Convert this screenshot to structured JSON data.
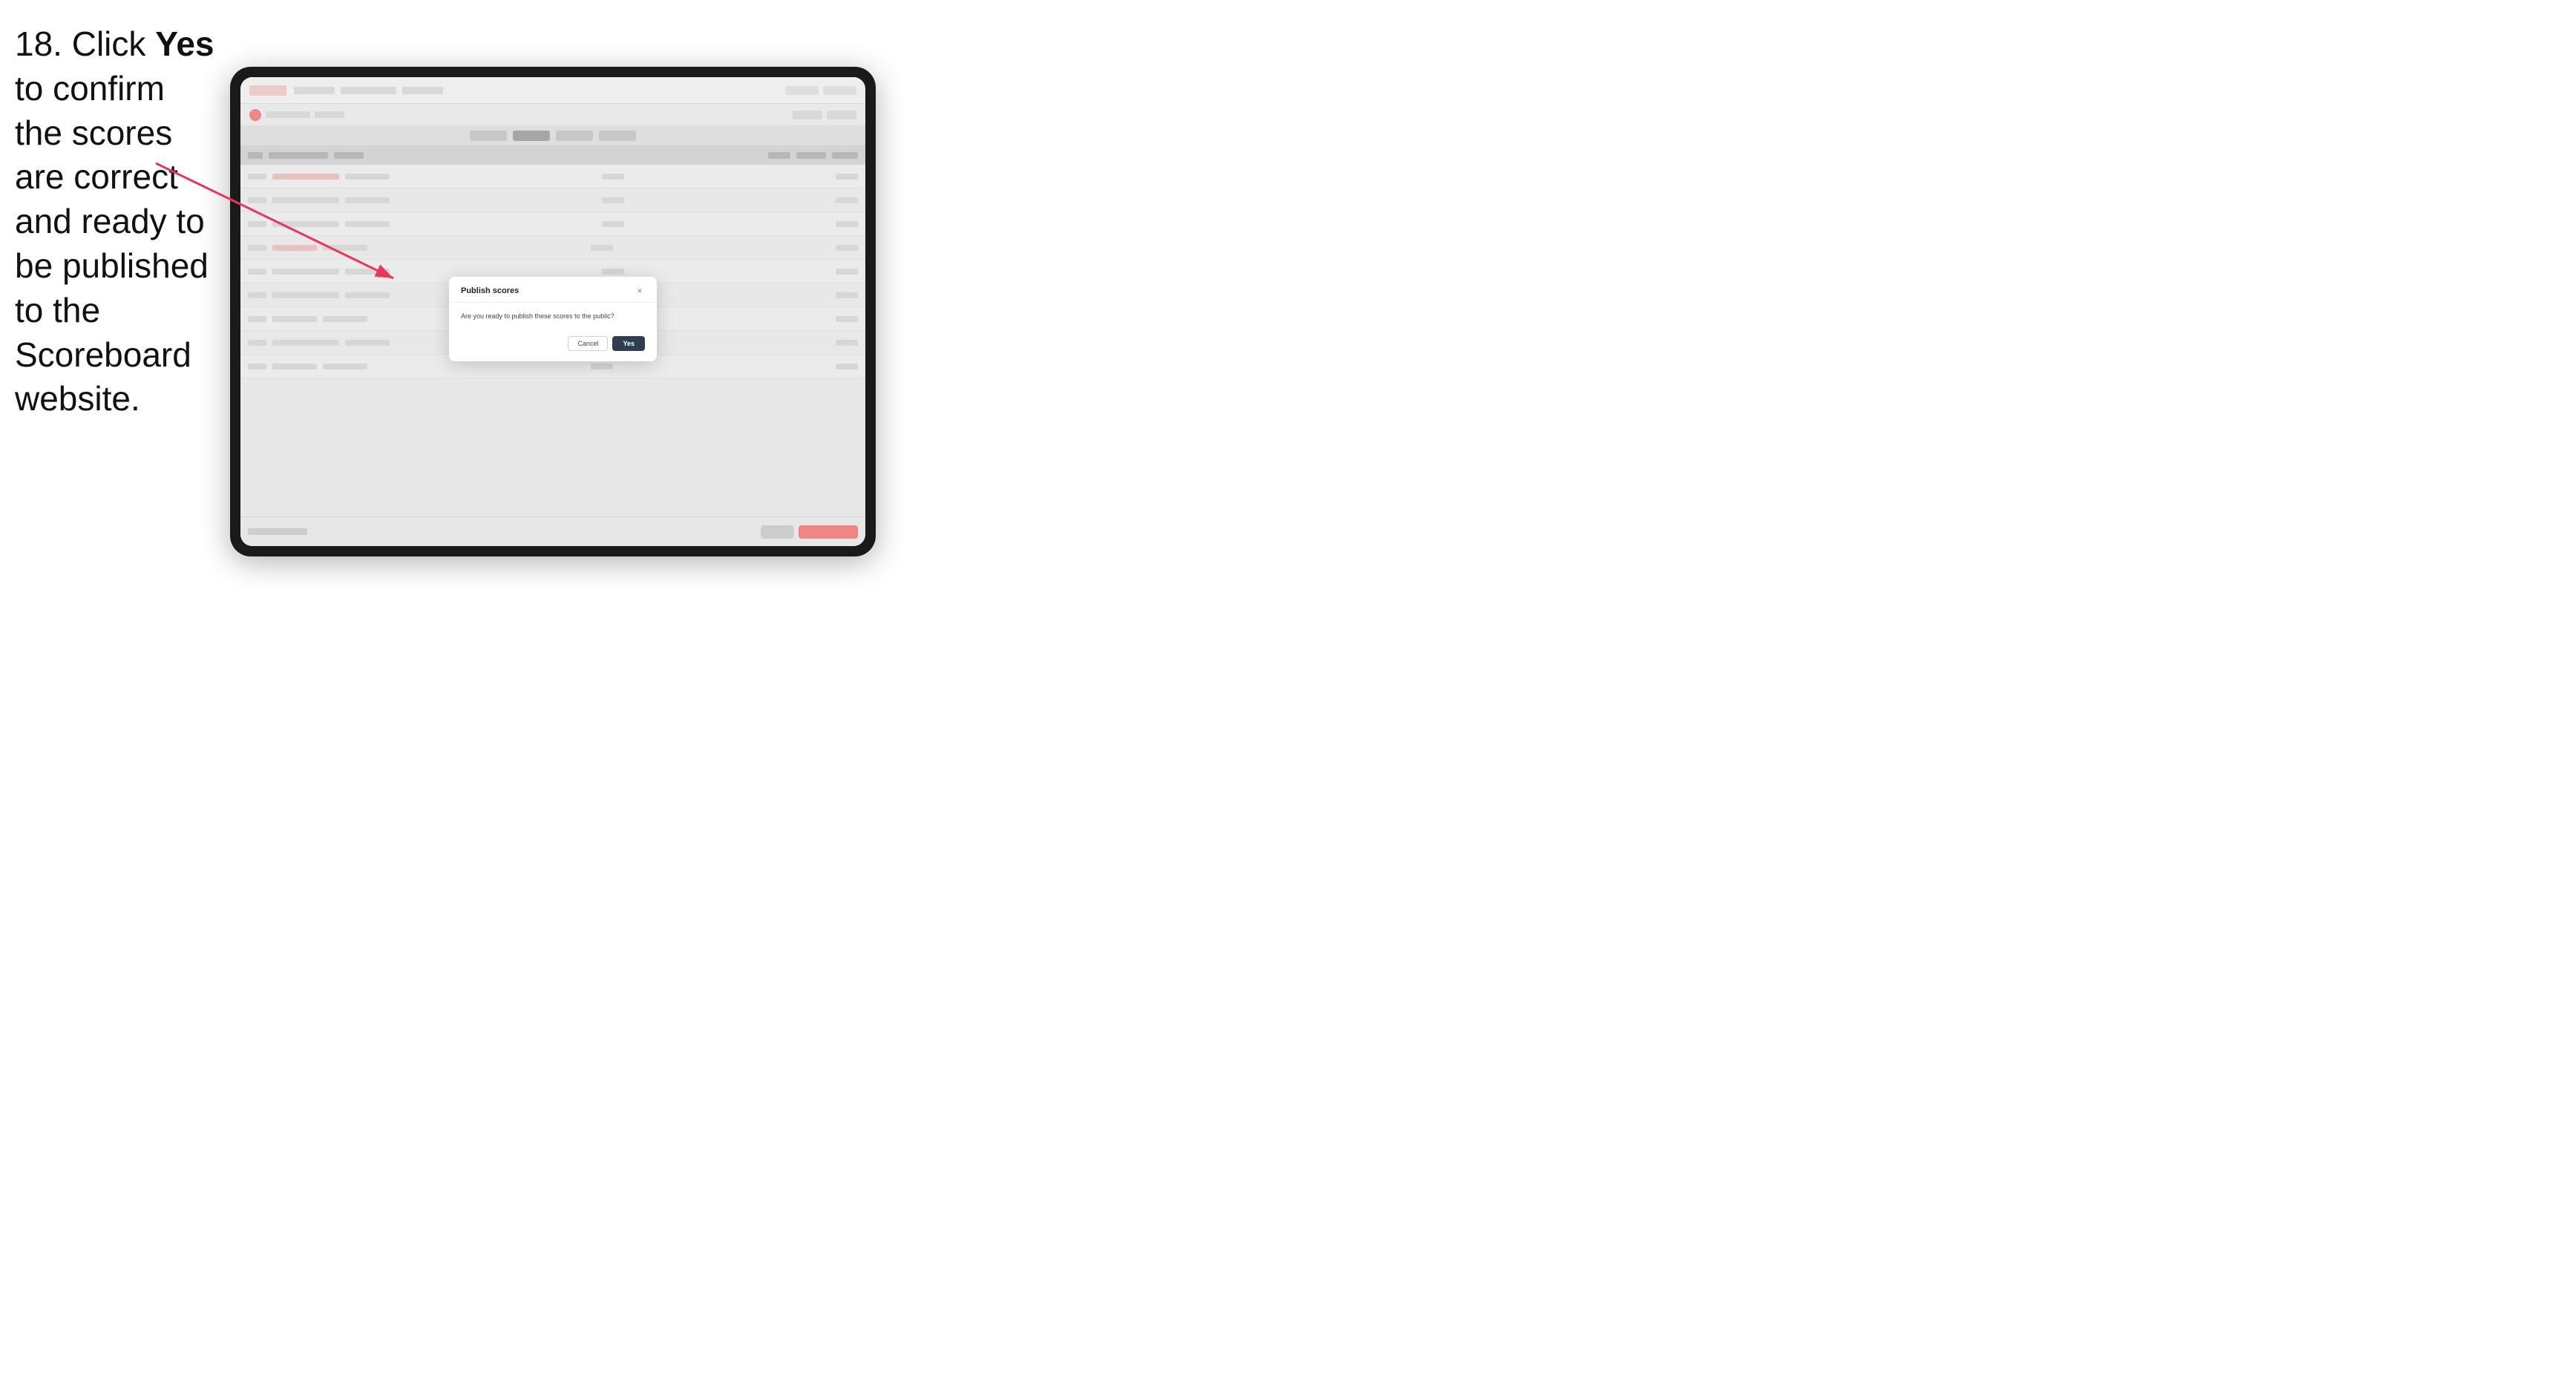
{
  "instruction": {
    "step_number": "18.",
    "text_before": " Click ",
    "bold_word": "Yes",
    "text_after": " to confirm the scores are correct and ready to be published to the Scoreboard website."
  },
  "modal": {
    "title": "Publish scores",
    "message": "Are you ready to publish these scores to the public?",
    "close_label": "×",
    "cancel_label": "Cancel",
    "yes_label": "Yes"
  },
  "colors": {
    "yes_button_bg": "#2c3e50",
    "cancel_button_border": "#d0d0d0",
    "modal_bg": "#ffffff",
    "arrow_color": "#e8365d"
  }
}
